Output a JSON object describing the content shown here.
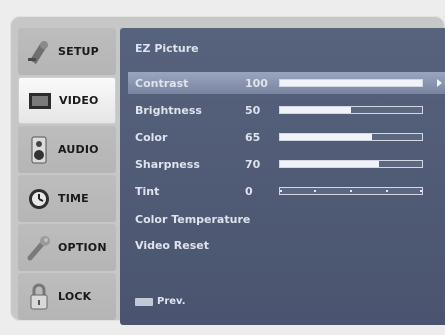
{
  "sidebar": {
    "items": [
      {
        "label": "SETUP",
        "icon": "satellite-icon"
      },
      {
        "label": "VIDEO",
        "icon": "screen-icon"
      },
      {
        "label": "AUDIO",
        "icon": "speaker-icon"
      },
      {
        "label": "TIME",
        "icon": "clock-icon"
      },
      {
        "label": "OPTION",
        "icon": "wrench-icon"
      },
      {
        "label": "LOCK",
        "icon": "padlock-icon"
      }
    ],
    "active_index": 1
  },
  "panel": {
    "title": "EZ Picture",
    "rows": [
      {
        "label": "Contrast",
        "value": "100",
        "level": 1.0
      },
      {
        "label": "Brightness",
        "value": "50",
        "level": 0.5
      },
      {
        "label": "Color",
        "value": "65",
        "level": 0.65
      },
      {
        "label": "Sharpness",
        "value": "70",
        "level": 0.7
      },
      {
        "label": "Tint",
        "value": "0",
        "level": 0.5
      }
    ],
    "links": [
      {
        "label": "Color Temperature"
      },
      {
        "label": "Video Reset"
      }
    ],
    "footer_label": "Prev."
  },
  "colors": {
    "panel": "#4e5873",
    "selected_row": "#8c97b0",
    "sidebar": "#b8b8b8",
    "active_item": "#f2f2f2"
  }
}
